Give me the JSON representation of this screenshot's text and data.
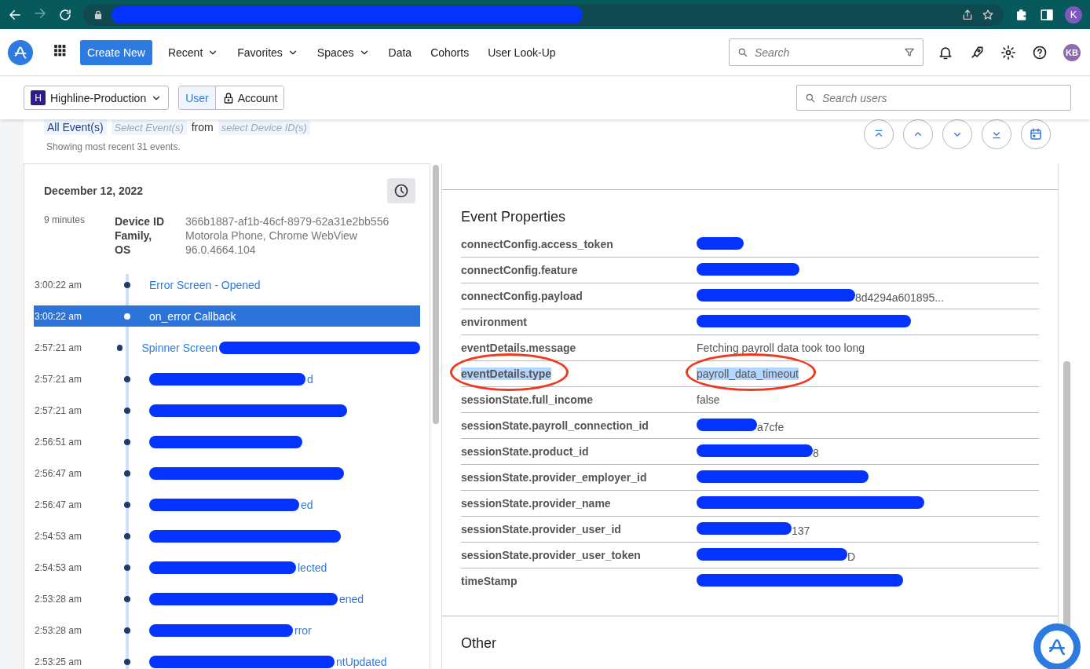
{
  "browser": {
    "avatar": "K"
  },
  "nav": {
    "create_button": "Create New",
    "menus": [
      {
        "label": "Recent",
        "dropdown": true
      },
      {
        "label": "Favorites",
        "dropdown": true
      },
      {
        "label": "Spaces",
        "dropdown": true
      },
      {
        "label": "Data",
        "dropdown": false
      },
      {
        "label": "Cohorts",
        "dropdown": false
      },
      {
        "label": "User Look-Up",
        "dropdown": false
      }
    ],
    "search": {
      "placeholder": "Search"
    },
    "avatar": "KB"
  },
  "subbar": {
    "project": {
      "badge": "H",
      "name": "Highline-Production"
    },
    "toggle": [
      {
        "label": "User",
        "selected": true,
        "locked": false
      },
      {
        "label": "Account",
        "selected": false,
        "locked": true
      }
    ],
    "search": {
      "placeholder": "Search users"
    }
  },
  "filter": {
    "events": "All Event(s)",
    "select_events": "Select Event(s)",
    "from": "from",
    "device": "select Device ID(s)",
    "summary": "Showing most recent 31 events."
  },
  "stream": {
    "date": "December 12, 2022",
    "duration": "9 minutes",
    "device_labels": [
      "Device ID",
      "Family,",
      "OS"
    ],
    "device_values": [
      "366b1887-af1b-46cf-8979-62a31e2bb556",
      "Motorola Phone, Chrome WebView",
      "96.0.4664.104"
    ],
    "events": [
      {
        "time": "3:00:22 am",
        "name": "Error Screen - Opened",
        "kind": "plain",
        "selected": false
      },
      {
        "time": "3:00:22 am",
        "name": "on_error Callback",
        "kind": "plain",
        "selected": true
      },
      {
        "time": "2:57:21 am",
        "name": "Spinner Screen",
        "kind": "tailmasked",
        "selected": false
      },
      {
        "time": "2:57:21 am",
        "name": "d",
        "kind": "headmasked",
        "selected": false
      },
      {
        "time": "2:57:21 am",
        "kind": "masked",
        "selected": false
      },
      {
        "time": "2:56:51 am",
        "kind": "masked",
        "selected": false
      },
      {
        "time": "2:56:47 am",
        "kind": "masked",
        "selected": false
      },
      {
        "time": "2:56:47 am",
        "name": "ed",
        "kind": "headmasked",
        "selected": false
      },
      {
        "time": "2:54:53 am",
        "kind": "masked",
        "selected": false
      },
      {
        "time": "2:54:53 am",
        "name": "lected",
        "kind": "headmasked",
        "selected": false
      },
      {
        "time": "2:53:28 am",
        "name": "ened",
        "kind": "headmasked",
        "selected": false
      },
      {
        "time": "2:53:28 am",
        "name": "rror",
        "kind": "headmasked",
        "selected": false
      },
      {
        "time": "2:53:25 am",
        "name": "ntUpdated",
        "kind": "headmasked",
        "selected": false
      }
    ]
  },
  "details": {
    "sections": [
      {
        "title": "Event Properties",
        "rows": [
          {
            "name": "connectConfig.access_token",
            "kind": "masked",
            "highlighted": false,
            "annotated": false
          },
          {
            "name": "connectConfig.feature",
            "kind": "masked",
            "highlighted": false,
            "annotated": false
          },
          {
            "name": "connectConfig.payload",
            "value": "8d4294a601895...",
            "kind": "headmasked",
            "highlighted": false,
            "annotated": false
          },
          {
            "name": "environment",
            "kind": "masked",
            "highlighted": false,
            "annotated": false
          },
          {
            "name": "eventDetails.message",
            "value": "Fetching payroll data took too long",
            "kind": "plain",
            "highlighted": false,
            "annotated": false
          },
          {
            "name": "eventDetails.type",
            "value": "payroll_data_timeout",
            "kind": "plain",
            "highlighted": true,
            "annotated": true
          },
          {
            "name": "sessionState.full_income",
            "value": "false",
            "kind": "plain",
            "highlighted": false,
            "annotated": false
          },
          {
            "name": "sessionState.payroll_connection_id",
            "value": "a7cfe",
            "kind": "headmasked",
            "highlighted": false,
            "annotated": false
          },
          {
            "name": "sessionState.product_id",
            "value": "8",
            "kind": "headmasked",
            "highlighted": false,
            "annotated": false
          },
          {
            "name": "sessionState.provider_employer_id",
            "kind": "masked",
            "highlighted": false,
            "annotated": false
          },
          {
            "name": "sessionState.provider_name",
            "kind": "masked",
            "highlighted": false,
            "annotated": false
          },
          {
            "name": "sessionState.provider_user_id",
            "value": "137",
            "kind": "headmasked",
            "highlighted": false,
            "annotated": false
          },
          {
            "name": "sessionState.provider_user_token",
            "value": "D",
            "kind": "headmasked",
            "highlighted": false,
            "annotated": false
          },
          {
            "name": "timeStamp",
            "kind": "masked",
            "highlighted": false,
            "annotated": false
          }
        ]
      },
      {
        "title": "Other"
      }
    ]
  }
}
